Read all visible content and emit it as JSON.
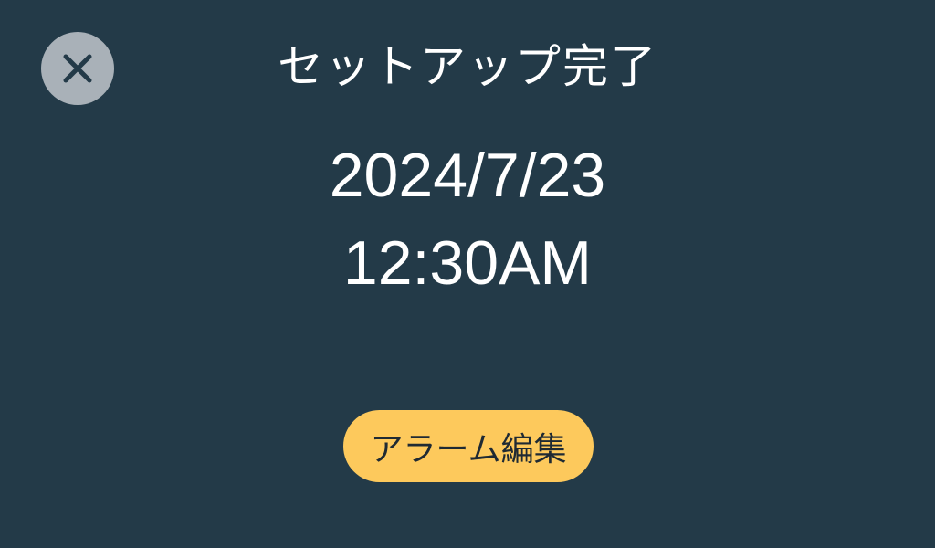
{
  "screen": {
    "title": "セットアップ完了",
    "date": "2024/7/23",
    "time": "12:30AM"
  },
  "close_button": {
    "icon": "close-icon"
  },
  "edit_button": {
    "label": "アラーム編集"
  },
  "colors": {
    "background": "#233a48",
    "close_button_bg": "#a9b1b8",
    "close_icon": "#233a48",
    "accent": "#fdc95c",
    "text": "#ffffff",
    "button_text": "#1f2a33"
  }
}
